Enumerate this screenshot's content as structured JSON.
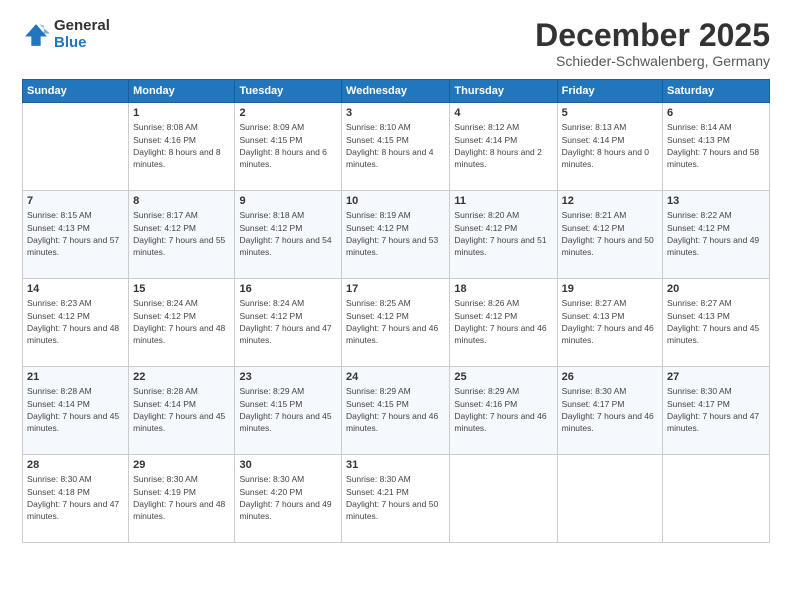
{
  "header": {
    "logo_general": "General",
    "logo_blue": "Blue",
    "month_title": "December 2025",
    "location": "Schieder-Schwalenberg, Germany"
  },
  "days_of_week": [
    "Sunday",
    "Monday",
    "Tuesday",
    "Wednesday",
    "Thursday",
    "Friday",
    "Saturday"
  ],
  "weeks": [
    [
      {
        "day": "",
        "sunrise": "",
        "sunset": "",
        "daylight": ""
      },
      {
        "day": "1",
        "sunrise": "Sunrise: 8:08 AM",
        "sunset": "Sunset: 4:16 PM",
        "daylight": "Daylight: 8 hours and 8 minutes."
      },
      {
        "day": "2",
        "sunrise": "Sunrise: 8:09 AM",
        "sunset": "Sunset: 4:15 PM",
        "daylight": "Daylight: 8 hours and 6 minutes."
      },
      {
        "day": "3",
        "sunrise": "Sunrise: 8:10 AM",
        "sunset": "Sunset: 4:15 PM",
        "daylight": "Daylight: 8 hours and 4 minutes."
      },
      {
        "day": "4",
        "sunrise": "Sunrise: 8:12 AM",
        "sunset": "Sunset: 4:14 PM",
        "daylight": "Daylight: 8 hours and 2 minutes."
      },
      {
        "day": "5",
        "sunrise": "Sunrise: 8:13 AM",
        "sunset": "Sunset: 4:14 PM",
        "daylight": "Daylight: 8 hours and 0 minutes."
      },
      {
        "day": "6",
        "sunrise": "Sunrise: 8:14 AM",
        "sunset": "Sunset: 4:13 PM",
        "daylight": "Daylight: 7 hours and 58 minutes."
      }
    ],
    [
      {
        "day": "7",
        "sunrise": "Sunrise: 8:15 AM",
        "sunset": "Sunset: 4:13 PM",
        "daylight": "Daylight: 7 hours and 57 minutes."
      },
      {
        "day": "8",
        "sunrise": "Sunrise: 8:17 AM",
        "sunset": "Sunset: 4:12 PM",
        "daylight": "Daylight: 7 hours and 55 minutes."
      },
      {
        "day": "9",
        "sunrise": "Sunrise: 8:18 AM",
        "sunset": "Sunset: 4:12 PM",
        "daylight": "Daylight: 7 hours and 54 minutes."
      },
      {
        "day": "10",
        "sunrise": "Sunrise: 8:19 AM",
        "sunset": "Sunset: 4:12 PM",
        "daylight": "Daylight: 7 hours and 53 minutes."
      },
      {
        "day": "11",
        "sunrise": "Sunrise: 8:20 AM",
        "sunset": "Sunset: 4:12 PM",
        "daylight": "Daylight: 7 hours and 51 minutes."
      },
      {
        "day": "12",
        "sunrise": "Sunrise: 8:21 AM",
        "sunset": "Sunset: 4:12 PM",
        "daylight": "Daylight: 7 hours and 50 minutes."
      },
      {
        "day": "13",
        "sunrise": "Sunrise: 8:22 AM",
        "sunset": "Sunset: 4:12 PM",
        "daylight": "Daylight: 7 hours and 49 minutes."
      }
    ],
    [
      {
        "day": "14",
        "sunrise": "Sunrise: 8:23 AM",
        "sunset": "Sunset: 4:12 PM",
        "daylight": "Daylight: 7 hours and 48 minutes."
      },
      {
        "day": "15",
        "sunrise": "Sunrise: 8:24 AM",
        "sunset": "Sunset: 4:12 PM",
        "daylight": "Daylight: 7 hours and 48 minutes."
      },
      {
        "day": "16",
        "sunrise": "Sunrise: 8:24 AM",
        "sunset": "Sunset: 4:12 PM",
        "daylight": "Daylight: 7 hours and 47 minutes."
      },
      {
        "day": "17",
        "sunrise": "Sunrise: 8:25 AM",
        "sunset": "Sunset: 4:12 PM",
        "daylight": "Daylight: 7 hours and 46 minutes."
      },
      {
        "day": "18",
        "sunrise": "Sunrise: 8:26 AM",
        "sunset": "Sunset: 4:12 PM",
        "daylight": "Daylight: 7 hours and 46 minutes."
      },
      {
        "day": "19",
        "sunrise": "Sunrise: 8:27 AM",
        "sunset": "Sunset: 4:13 PM",
        "daylight": "Daylight: 7 hours and 46 minutes."
      },
      {
        "day": "20",
        "sunrise": "Sunrise: 8:27 AM",
        "sunset": "Sunset: 4:13 PM",
        "daylight": "Daylight: 7 hours and 45 minutes."
      }
    ],
    [
      {
        "day": "21",
        "sunrise": "Sunrise: 8:28 AM",
        "sunset": "Sunset: 4:14 PM",
        "daylight": "Daylight: 7 hours and 45 minutes."
      },
      {
        "day": "22",
        "sunrise": "Sunrise: 8:28 AM",
        "sunset": "Sunset: 4:14 PM",
        "daylight": "Daylight: 7 hours and 45 minutes."
      },
      {
        "day": "23",
        "sunrise": "Sunrise: 8:29 AM",
        "sunset": "Sunset: 4:15 PM",
        "daylight": "Daylight: 7 hours and 45 minutes."
      },
      {
        "day": "24",
        "sunrise": "Sunrise: 8:29 AM",
        "sunset": "Sunset: 4:15 PM",
        "daylight": "Daylight: 7 hours and 46 minutes."
      },
      {
        "day": "25",
        "sunrise": "Sunrise: 8:29 AM",
        "sunset": "Sunset: 4:16 PM",
        "daylight": "Daylight: 7 hours and 46 minutes."
      },
      {
        "day": "26",
        "sunrise": "Sunrise: 8:30 AM",
        "sunset": "Sunset: 4:17 PM",
        "daylight": "Daylight: 7 hours and 46 minutes."
      },
      {
        "day": "27",
        "sunrise": "Sunrise: 8:30 AM",
        "sunset": "Sunset: 4:17 PM",
        "daylight": "Daylight: 7 hours and 47 minutes."
      }
    ],
    [
      {
        "day": "28",
        "sunrise": "Sunrise: 8:30 AM",
        "sunset": "Sunset: 4:18 PM",
        "daylight": "Daylight: 7 hours and 47 minutes."
      },
      {
        "day": "29",
        "sunrise": "Sunrise: 8:30 AM",
        "sunset": "Sunset: 4:19 PM",
        "daylight": "Daylight: 7 hours and 48 minutes."
      },
      {
        "day": "30",
        "sunrise": "Sunrise: 8:30 AM",
        "sunset": "Sunset: 4:20 PM",
        "daylight": "Daylight: 7 hours and 49 minutes."
      },
      {
        "day": "31",
        "sunrise": "Sunrise: 8:30 AM",
        "sunset": "Sunset: 4:21 PM",
        "daylight": "Daylight: 7 hours and 50 minutes."
      },
      {
        "day": "",
        "sunrise": "",
        "sunset": "",
        "daylight": ""
      },
      {
        "day": "",
        "sunrise": "",
        "sunset": "",
        "daylight": ""
      },
      {
        "day": "",
        "sunrise": "",
        "sunset": "",
        "daylight": ""
      }
    ]
  ]
}
